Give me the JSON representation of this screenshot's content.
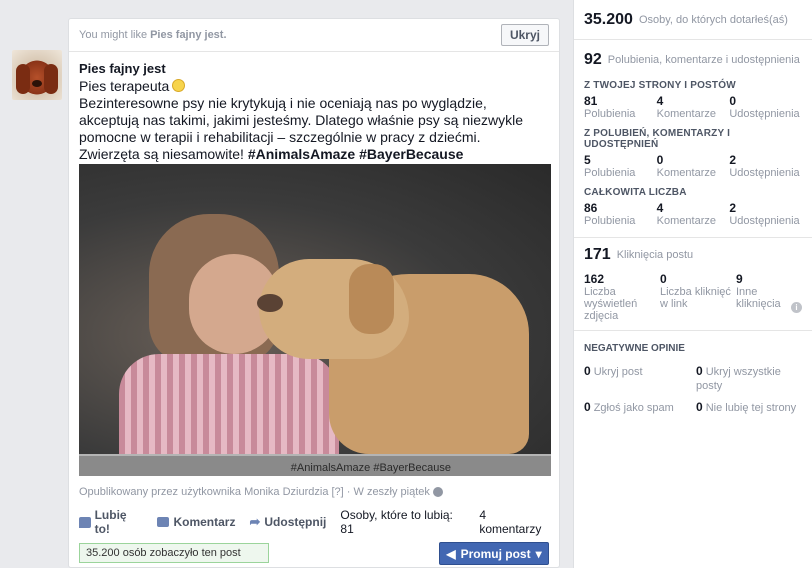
{
  "suggestion": {
    "prefix": "You might like",
    "page": "Pies fajny jest.",
    "hide_label": "Ukryj"
  },
  "post": {
    "page_name": "Pies fajny jest",
    "subtitle": "Pies terapeuta",
    "text": "Bezinteresowne psy nie krytykują i nie oceniają nas po wyglądzie, akceptują nas takimi, jakimi jesteśmy. Dlatego właśnie psy są niezwykle pomocne w terapii i rehabilitacji – szczególnie w pracy z dziećmi.",
    "text_last": "Zwierzęta są niesamowite!",
    "hashtags": "#AnimalsAmaze #BayerBecause",
    "photo_caption": "#AnimalsAmaze    #BayerBecause",
    "meta": "Opublikowany przez użytkownika Monika Dziurdzia [?] · W zeszły piątek"
  },
  "actions": {
    "like": "Lubię to!",
    "comment": "Komentarz",
    "share": "Udostępnij",
    "likes_text": "Osoby, które to lubią: 81",
    "comments_text": "4 komentarzy"
  },
  "footer": {
    "reach_text": "35.200 osób zobaczyło ten post",
    "promote_label": "Promuj post"
  },
  "insights": {
    "reach_value": "35.200",
    "reach_label": "Osoby, do których dotarłeś(aś)",
    "engagement_value": "92",
    "engagement_label": "Polubienia, komentarze i udostępnienia",
    "groups": [
      {
        "title": "Z TWOJEJ STRONY I POSTÓW",
        "values": [
          "81",
          "4",
          "0"
        ]
      },
      {
        "title": "Z POLUBIEŃ, KOMENTARZY I UDOSTĘPNIEŃ",
        "values": [
          "5",
          "0",
          "2"
        ]
      },
      {
        "title": "CAŁKOWITA LICZBA",
        "values": [
          "86",
          "4",
          "2"
        ]
      }
    ],
    "group_labels": [
      "Polubienia",
      "Komentarze",
      "Udostępnienia"
    ],
    "clicks_value": "171",
    "clicks_label": "Kliknięcia postu",
    "clicks": [
      {
        "value": "162",
        "label": "Liczba wyświetleń zdjęcia"
      },
      {
        "value": "0",
        "label": "Liczba kliknięć w link"
      },
      {
        "value": "9",
        "label": "Inne kliknięcia"
      }
    ],
    "negative_title": "NEGATYWNE OPINIE",
    "negative": [
      {
        "value": "0",
        "label": "Ukryj post"
      },
      {
        "value": "0",
        "label": "Ukryj wszystkie posty"
      },
      {
        "value": "0",
        "label": "Zgłoś jako spam"
      },
      {
        "value": "0",
        "label": "Nie lubię tej strony"
      }
    ]
  }
}
